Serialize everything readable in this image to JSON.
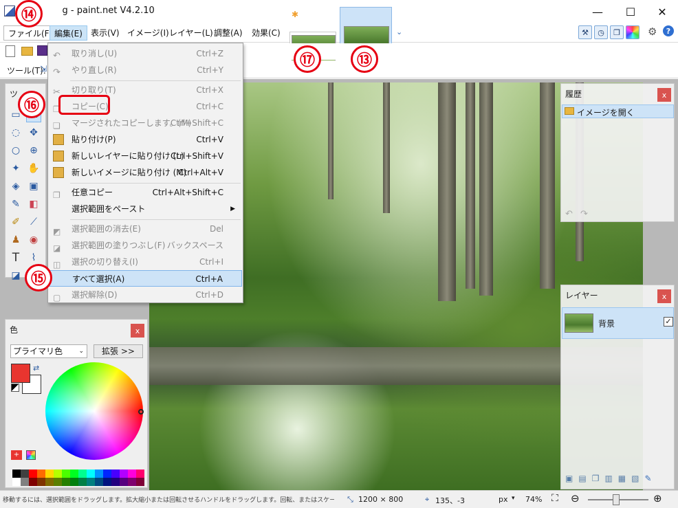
{
  "window": {
    "title": "10.png - paint.net V4.2.10",
    "title_visible": "10",
    "title_tail": "g - paint.net V4.2.10",
    "minimize": "—",
    "maximize": "☐",
    "close": "✕"
  },
  "menubar": {
    "items": [
      "ファイル(F)",
      "編集(E)",
      "表示(V)",
      "イメージ(I)",
      "レイヤー(L)",
      "調整(A)",
      "効果(C)"
    ]
  },
  "toolbar": {
    "tool_label": "ツール(T):",
    "overflow": "⌄"
  },
  "tool_window": {
    "title": "ツ"
  },
  "edit_menu": {
    "items": [
      {
        "label": "取り消し(U)",
        "shortcut": "Ctrl+Z",
        "enabled": false
      },
      {
        "label": "やり直し(R)",
        "shortcut": "Ctrl+Y",
        "enabled": false
      },
      {
        "label": "切り取り(T)",
        "shortcut": "Ctrl+X",
        "enabled": false
      },
      {
        "label": "コピー(C)",
        "shortcut": "Ctrl+C",
        "enabled": false
      },
      {
        "label": "マージされたコピーします。(M)",
        "shortcut": "Ctrl+Shift+C",
        "enabled": false
      },
      {
        "label": "貼り付け(P)",
        "shortcut": "Ctrl+V",
        "enabled": true
      },
      {
        "label": "新しいレイヤーに貼り付け (L)",
        "shortcut": "Ctrl+Shift+V",
        "enabled": true
      },
      {
        "label": "新しいイメージに貼り付け (M)",
        "shortcut": "Ctrl+Alt+V",
        "enabled": true
      },
      {
        "label": "任意コピー",
        "shortcut": "Ctrl+Alt+Shift+C",
        "enabled": true
      },
      {
        "label": "選択範囲をペースト",
        "shortcut": "",
        "enabled": true
      },
      {
        "label": "選択範囲の消去(E)",
        "shortcut": "Del",
        "enabled": false
      },
      {
        "label": "選択範囲の塗りつぶし(F)",
        "shortcut": "バックスペース",
        "enabled": false
      },
      {
        "label": "選択の切り替え(I)",
        "shortcut": "Ctrl+I",
        "enabled": false
      },
      {
        "label": "すべて選択(A)",
        "shortcut": "Ctrl+A",
        "enabled": true
      },
      {
        "label": "選択解除(D)",
        "shortcut": "Ctrl+D",
        "enabled": false
      }
    ]
  },
  "history_panel": {
    "title": "履歴",
    "close": "x",
    "items": [
      "イメージを開く"
    ]
  },
  "layers_panel": {
    "title": "レイヤー",
    "close": "x",
    "layers": [
      {
        "name": "背景",
        "visible": true
      }
    ]
  },
  "colors_panel": {
    "title": "色",
    "close": "x",
    "mode": "プライマリ色",
    "expand_button": "拡張 >>",
    "primary_color": "#e8352f",
    "secondary_color": "#ffffff"
  },
  "annotations": [
    "⑭",
    "⑯",
    "⑮",
    "⑰",
    "⑬"
  ],
  "statusbar": {
    "hint": "移動するには、選択範囲をドラッグします。拡大縮小または回転させるハンドルをドラッグします。回転、またはスケーリングを制約するには、shift キーを押し。",
    "image_size": "1200 × 800",
    "cursor_pos": "135、-3",
    "unit": "px",
    "zoom": "74%"
  }
}
